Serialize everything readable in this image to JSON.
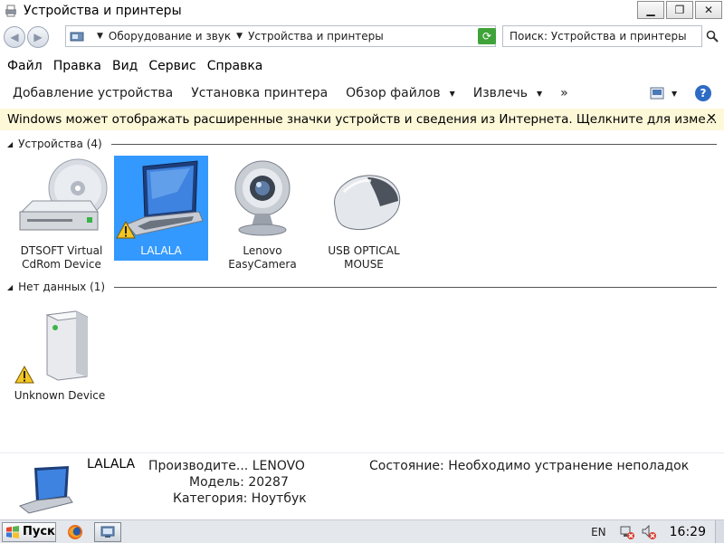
{
  "window": {
    "title": "Устройства и принтеры",
    "btn_min": "▁",
    "btn_max": "❐",
    "btn_close": "✕"
  },
  "address": {
    "back_glyph": "◀",
    "forward_glyph": "▶",
    "crumbs": [
      "Оборудование и звук",
      "Устройства и принтеры"
    ],
    "search_placeholder": "Поиск: Устройства и принтеры"
  },
  "menu": [
    "Файл",
    "Правка",
    "Вид",
    "Сервис",
    "Справка"
  ],
  "commands": {
    "add_device": "Добавление устройства",
    "add_printer": "Установка принтера",
    "browse_files": "Обзор файлов",
    "eject": "Извлечь",
    "more": "»",
    "help": "?"
  },
  "infobar": {
    "text": "Windows может отображать расширенные значки устройств и сведения из Интернета.  Щелкните для изме...",
    "close": "✕"
  },
  "groups": {
    "devices_header": "Устройства (4)",
    "nodata_header": "Нет данных (1)"
  },
  "devices": [
    {
      "label_line1": "DTSOFT Virtual",
      "label_line2": "CdRom Device"
    },
    {
      "label_line1": "LALALA",
      "label_line2": ""
    },
    {
      "label_line1": "Lenovo",
      "label_line2": "EasyCamera"
    },
    {
      "label_line1": "USB OPTICAL",
      "label_line2": "MOUSE"
    }
  ],
  "nodata_devices": [
    {
      "label_line1": "Unknown Device",
      "label_line2": ""
    }
  ],
  "details": {
    "name": "LALALA",
    "manufacturer_key": "Производите...",
    "manufacturer_val": "LENOVO",
    "model_key": "Модель:",
    "model_val": "20287",
    "category_key": "Категория:",
    "category_val": "Ноутбук",
    "status_key": "Состояние:",
    "status_val": "Необходимо устранение неполадок"
  },
  "taskbar": {
    "start": "Пуск",
    "lang": "EN",
    "clock": "16:29"
  },
  "colors": {
    "selection": "#3399ff",
    "infobar_bg": "#fcf8d8"
  }
}
